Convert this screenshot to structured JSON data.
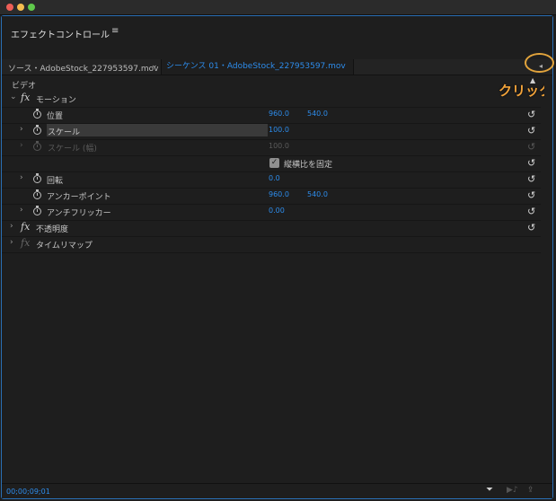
{
  "window": {
    "title": "エフェクトコントロール",
    "menu_icon": "hamburger-icon"
  },
  "tabs": {
    "source": "ソース・AdobeStock_227953597.mov",
    "sequence": "シーケンス 01・AdobeStock_227953597.mov"
  },
  "annotation": {
    "click_label": "クリック",
    "highlight_color": "#e2a43c"
  },
  "section": {
    "video": "ビデオ"
  },
  "effects": {
    "motion": {
      "label": "モーション",
      "position": {
        "label": "位置",
        "x": "960.0",
        "y": "540.0"
      },
      "scale": {
        "label": "スケール",
        "value": "100.0"
      },
      "scale_width": {
        "label": "スケール (幅)",
        "value": "100.0"
      },
      "uniform": {
        "label": "縦横比を固定",
        "checked": true
      },
      "rotation": {
        "label": "回転",
        "value": "0.0"
      },
      "anchor": {
        "label": "アンカーポイント",
        "x": "960.0",
        "y": "540.0"
      },
      "antiflicker": {
        "label": "アンチフリッカー",
        "value": "0.00"
      }
    },
    "opacity": {
      "label": "不透明度"
    },
    "time_remap": {
      "label": "タイムリマップ"
    }
  },
  "footer": {
    "timecode": "00;00;09;01"
  },
  "colors": {
    "accent": "#2d8ceb",
    "panel_border": "#2a6fb5",
    "bg": "#1e1e1e"
  }
}
